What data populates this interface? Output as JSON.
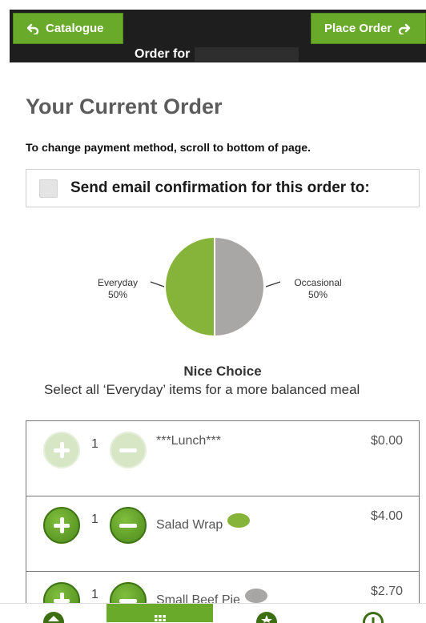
{
  "header": {
    "catalogue_label": "Catalogue",
    "place_order_label": "Place Order",
    "order_for_label": "Order for"
  },
  "page": {
    "title": "Your Current Order",
    "payment_note": "To change payment method, scroll to bottom of page.",
    "email_confirmation_label": "Send email confirmation for this order to:"
  },
  "chart_data": {
    "type": "pie",
    "slices": [
      {
        "label": "Everyday",
        "value": 50,
        "display": "50%",
        "color": "#86b33a"
      },
      {
        "label": "Occasional",
        "value": 50,
        "display": "50%",
        "color": "#a9a6a6"
      }
    ]
  },
  "advice": {
    "title": "Nice Choice",
    "description": "Select all ‘Everyday’ items for a more balanced meal"
  },
  "items": [
    {
      "quantity": "1",
      "name": "***Lunch***",
      "price": "$0.00",
      "category_color": null,
      "enabled": false
    },
    {
      "quantity": "1",
      "name": "Salad Wrap",
      "price": "$4.00",
      "category_color": "#86b33a",
      "enabled": true
    },
    {
      "quantity": "1",
      "name": "Small Beef Pie",
      "price": "$2.70",
      "category_color": "#a9a6a6",
      "enabled": true
    }
  ],
  "bottom_nav": {
    "items": [
      "home-icon",
      "grid-icon",
      "star-icon",
      "info-icon"
    ],
    "active_index": 1
  },
  "colors": {
    "accent_green": "#6aaa2a",
    "header_bg": "#1e1e1e"
  }
}
